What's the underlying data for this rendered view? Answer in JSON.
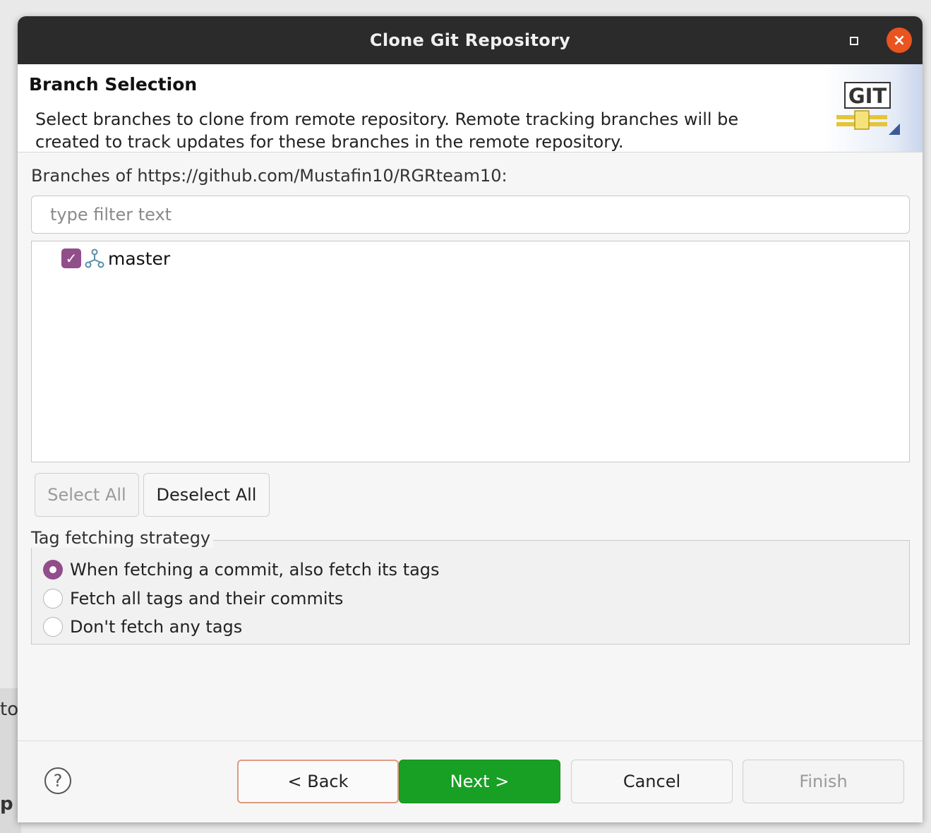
{
  "background": {
    "fragment_1": "to",
    "fragment_2": "p"
  },
  "titlebar": {
    "title": "Clone Git Repository",
    "maximize_icon": "maximize-icon",
    "close_icon": "close-icon",
    "close_glyph": "×",
    "close_color": "#e95420"
  },
  "header": {
    "title": "Branch Selection",
    "description": "Select branches to clone from remote repository. Remote tracking branches will be created to track updates for these branches in the remote repository.",
    "logo_text": "GIT"
  },
  "branches": {
    "label": "Branches of https://github.com/Mustafin10/RGRteam10:",
    "filter_placeholder": "type filter text",
    "items": [
      {
        "name": "master",
        "checked": true
      }
    ],
    "select_all_label": "Select All",
    "deselect_all_label": "Deselect All"
  },
  "tag_fetching": {
    "legend": "Tag fetching strategy",
    "options": [
      {
        "label": "When fetching a commit, also fetch its tags",
        "selected": true
      },
      {
        "label": "Fetch all tags and their commits",
        "selected": false
      },
      {
        "label": "Don't fetch any tags",
        "selected": false
      }
    ]
  },
  "footer": {
    "help_glyph": "?",
    "back_label": "< Back",
    "next_label": "Next >",
    "cancel_label": "Cancel",
    "finish_label": "Finish"
  },
  "colors": {
    "accent": "#924d8b",
    "primary_button": "#18a024",
    "titlebar": "#2b2b2b"
  }
}
